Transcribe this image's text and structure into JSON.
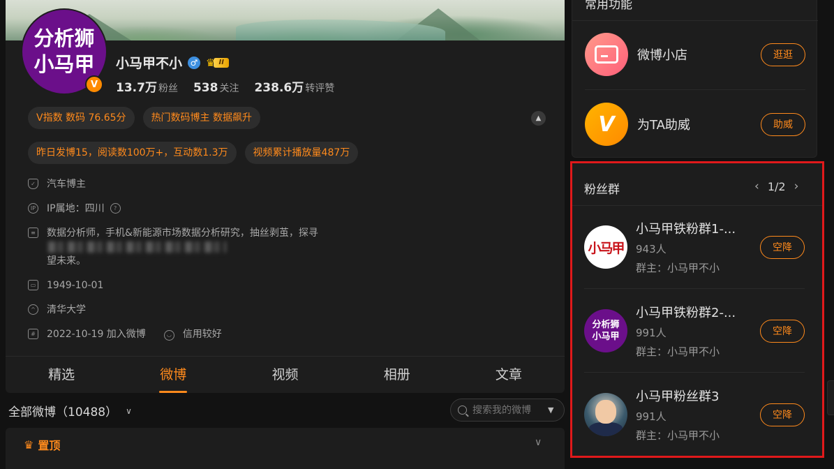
{
  "profile": {
    "avatar_lines": [
      "分析狮",
      "小马甲"
    ],
    "verified_badge": "V",
    "name": "小马甲不小",
    "gender_symbol": "♂",
    "level_badge": "II",
    "stats": [
      {
        "num": "13.7万",
        "label": "粉丝"
      },
      {
        "num": "538",
        "label": "关注"
      },
      {
        "num": "238.6万",
        "label": "转评赞"
      }
    ],
    "tags_row1": [
      "V指数 数码 76.65分",
      "热门数码博主 数据飙升"
    ],
    "tags_row2": [
      "昨日发博15，阅读数100万+，互动数1.3万",
      "视频累计播放量487万"
    ],
    "info": {
      "category": "汽车博主",
      "ip": "IP属地：四川",
      "description_visible": "数据分析师，手机&新能源市场数据分析研究，抽丝剥茧，探寻",
      "description_tail": "望未来。",
      "birthday": "1949-10-01",
      "school": "清华大学",
      "joined": "2022-10-19 加入微博",
      "credit": "信用较好"
    },
    "tabs": [
      "精选",
      "微博",
      "视频",
      "相册",
      "文章"
    ],
    "active_tab": "微博"
  },
  "feed": {
    "all_posts_label": "全部微博（10488）",
    "search_placeholder": "搜索我的微博",
    "pinned_label": "置顶"
  },
  "sidebar": {
    "functions": {
      "title": "常用功能",
      "items": [
        {
          "label": "微博小店",
          "button": "逛逛"
        },
        {
          "label": "为TA助威",
          "button": "助威"
        }
      ]
    },
    "fan_groups": {
      "title": "粉丝群",
      "pager": "1/2",
      "groups": [
        {
          "name": "小马甲铁粉群1-...",
          "count": "943人",
          "owner": "群主：小马甲不小",
          "button": "空降",
          "avatar_text": "小马甲"
        },
        {
          "name": "小马甲铁粉群2-...",
          "count": "991人",
          "owner": "群主：小马甲不小",
          "button": "空降",
          "avatar_lines": [
            "分析狮",
            "小马甲"
          ]
        },
        {
          "name": "小马甲粉丝群3",
          "count": "991人",
          "owner": "群主：小马甲不小",
          "button": "空降"
        }
      ]
    }
  },
  "colors": {
    "accent": "#ff8a1c",
    "highlight_frame": "#e0191b",
    "avatar_purple": "#6b0f8a"
  }
}
